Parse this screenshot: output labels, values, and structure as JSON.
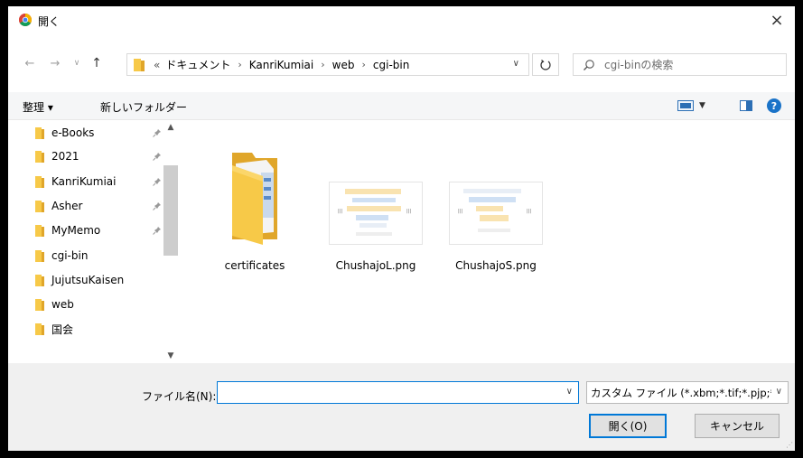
{
  "window": {
    "title": "開く",
    "close_label": "×"
  },
  "address": {
    "overflow": "«",
    "crumbs": [
      "ドキュメント",
      "KanriKumiai",
      "web",
      "cgi-bin"
    ],
    "separator": "›"
  },
  "search": {
    "placeholder": "cgi-binの検索"
  },
  "toolbar": {
    "organize": "整理 ▾",
    "new_folder": "新しいフォルダー",
    "help": "?"
  },
  "navpane": {
    "items": [
      {
        "label": "e-Books",
        "pinned": true
      },
      {
        "label": "2021",
        "pinned": true
      },
      {
        "label": "KanriKumiai",
        "pinned": true
      },
      {
        "label": "Asher",
        "pinned": true
      },
      {
        "label": "MyMemo",
        "pinned": true
      },
      {
        "label": "cgi-bin",
        "pinned": false
      },
      {
        "label": "JujutsuKaisen",
        "pinned": false
      },
      {
        "label": "web",
        "pinned": false
      },
      {
        "label": "国会",
        "pinned": false
      }
    ]
  },
  "files": [
    {
      "name": "certificates",
      "type": "folder"
    },
    {
      "name": "ChushajoL.png",
      "type": "image"
    },
    {
      "name": "ChushajoS.png",
      "type": "image"
    }
  ],
  "bottom": {
    "filename_label": "ファイル名(N):",
    "filename_value": "",
    "filter_value": "カスタム ファイル (*.xbm;*.tif;*.pjp;*",
    "open_label": "開く(O)",
    "cancel_label": "キャンセル"
  },
  "colors": {
    "accent": "#0078d7",
    "folder": "#f7c948",
    "toolbar_bg": "#f5f6f7",
    "bottom_bg": "#f0f0f0"
  }
}
